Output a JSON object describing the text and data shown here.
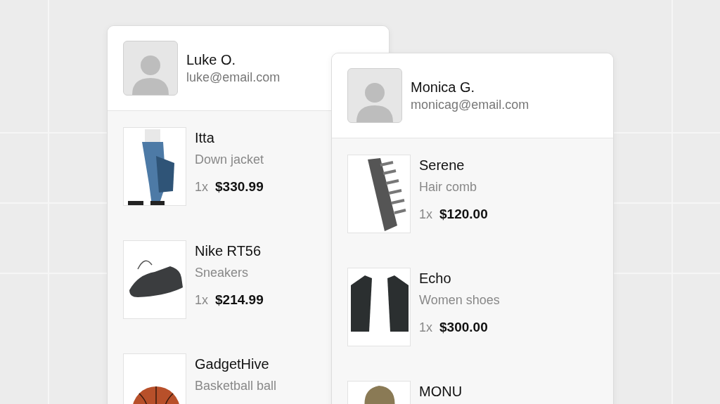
{
  "cards": [
    {
      "customer": {
        "name": "Luke O.",
        "email": "luke@email.com"
      },
      "items": [
        {
          "title": "Itta",
          "subtitle": "Down jacket",
          "quantity": "1x",
          "price": "$330.99"
        },
        {
          "title": "Nike RT56",
          "subtitle": "Sneakers",
          "quantity": "1x",
          "price": "$214.99"
        },
        {
          "title": "GadgetHive",
          "subtitle": "Basketball ball"
        }
      ]
    },
    {
      "customer": {
        "name": "Monica G.",
        "email": "monicag@email.com"
      },
      "items": [
        {
          "title": "Serene",
          "subtitle": "Hair comb",
          "quantity": "1x",
          "price": "$120.00"
        },
        {
          "title": "Echo",
          "subtitle": "Women shoes",
          "quantity": "1x",
          "price": "$300.00"
        },
        {
          "title": "MONU"
        }
      ]
    }
  ]
}
